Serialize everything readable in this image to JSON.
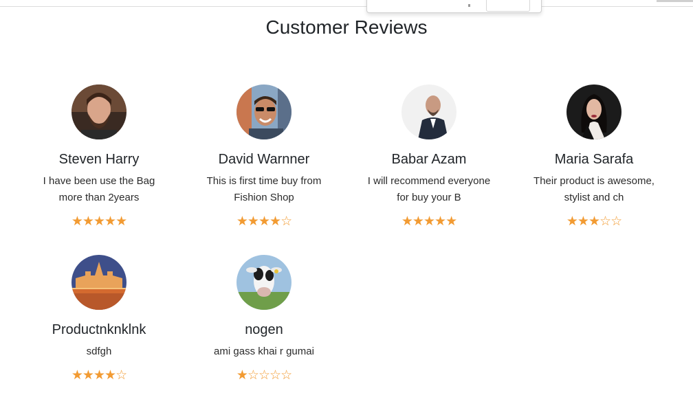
{
  "page": {
    "title": "Customer Reviews"
  },
  "colors": {
    "star": "#f29b33",
    "text": "#212529"
  },
  "reviews": [
    {
      "name": "Steven Harry",
      "text": "I have been use the Bag more than 2years",
      "rating": 5,
      "avatar_icon": "man-with-beard-avatar"
    },
    {
      "name": "David Warnner",
      "text": "This is first time buy from Fishion Shop",
      "rating": 4,
      "avatar_icon": "man-with-sunglasses-avatar"
    },
    {
      "name": "Babar Azam",
      "text": "I will recommend everyone for buy your B",
      "rating": 5,
      "avatar_icon": "bald-man-in-suit-avatar"
    },
    {
      "name": "Maria Sarafa",
      "text": "Their product is awesome, stylist and ch",
      "rating": 3,
      "avatar_icon": "woman-with-dark-hair-avatar"
    },
    {
      "name": "Productnknklnk",
      "text": "sdfgh",
      "rating": 4,
      "avatar_icon": "parliament-building-avatar"
    },
    {
      "name": "nogen",
      "text": "ami gass khai r gumai",
      "rating": 1,
      "avatar_icon": "cow-avatar"
    }
  ]
}
